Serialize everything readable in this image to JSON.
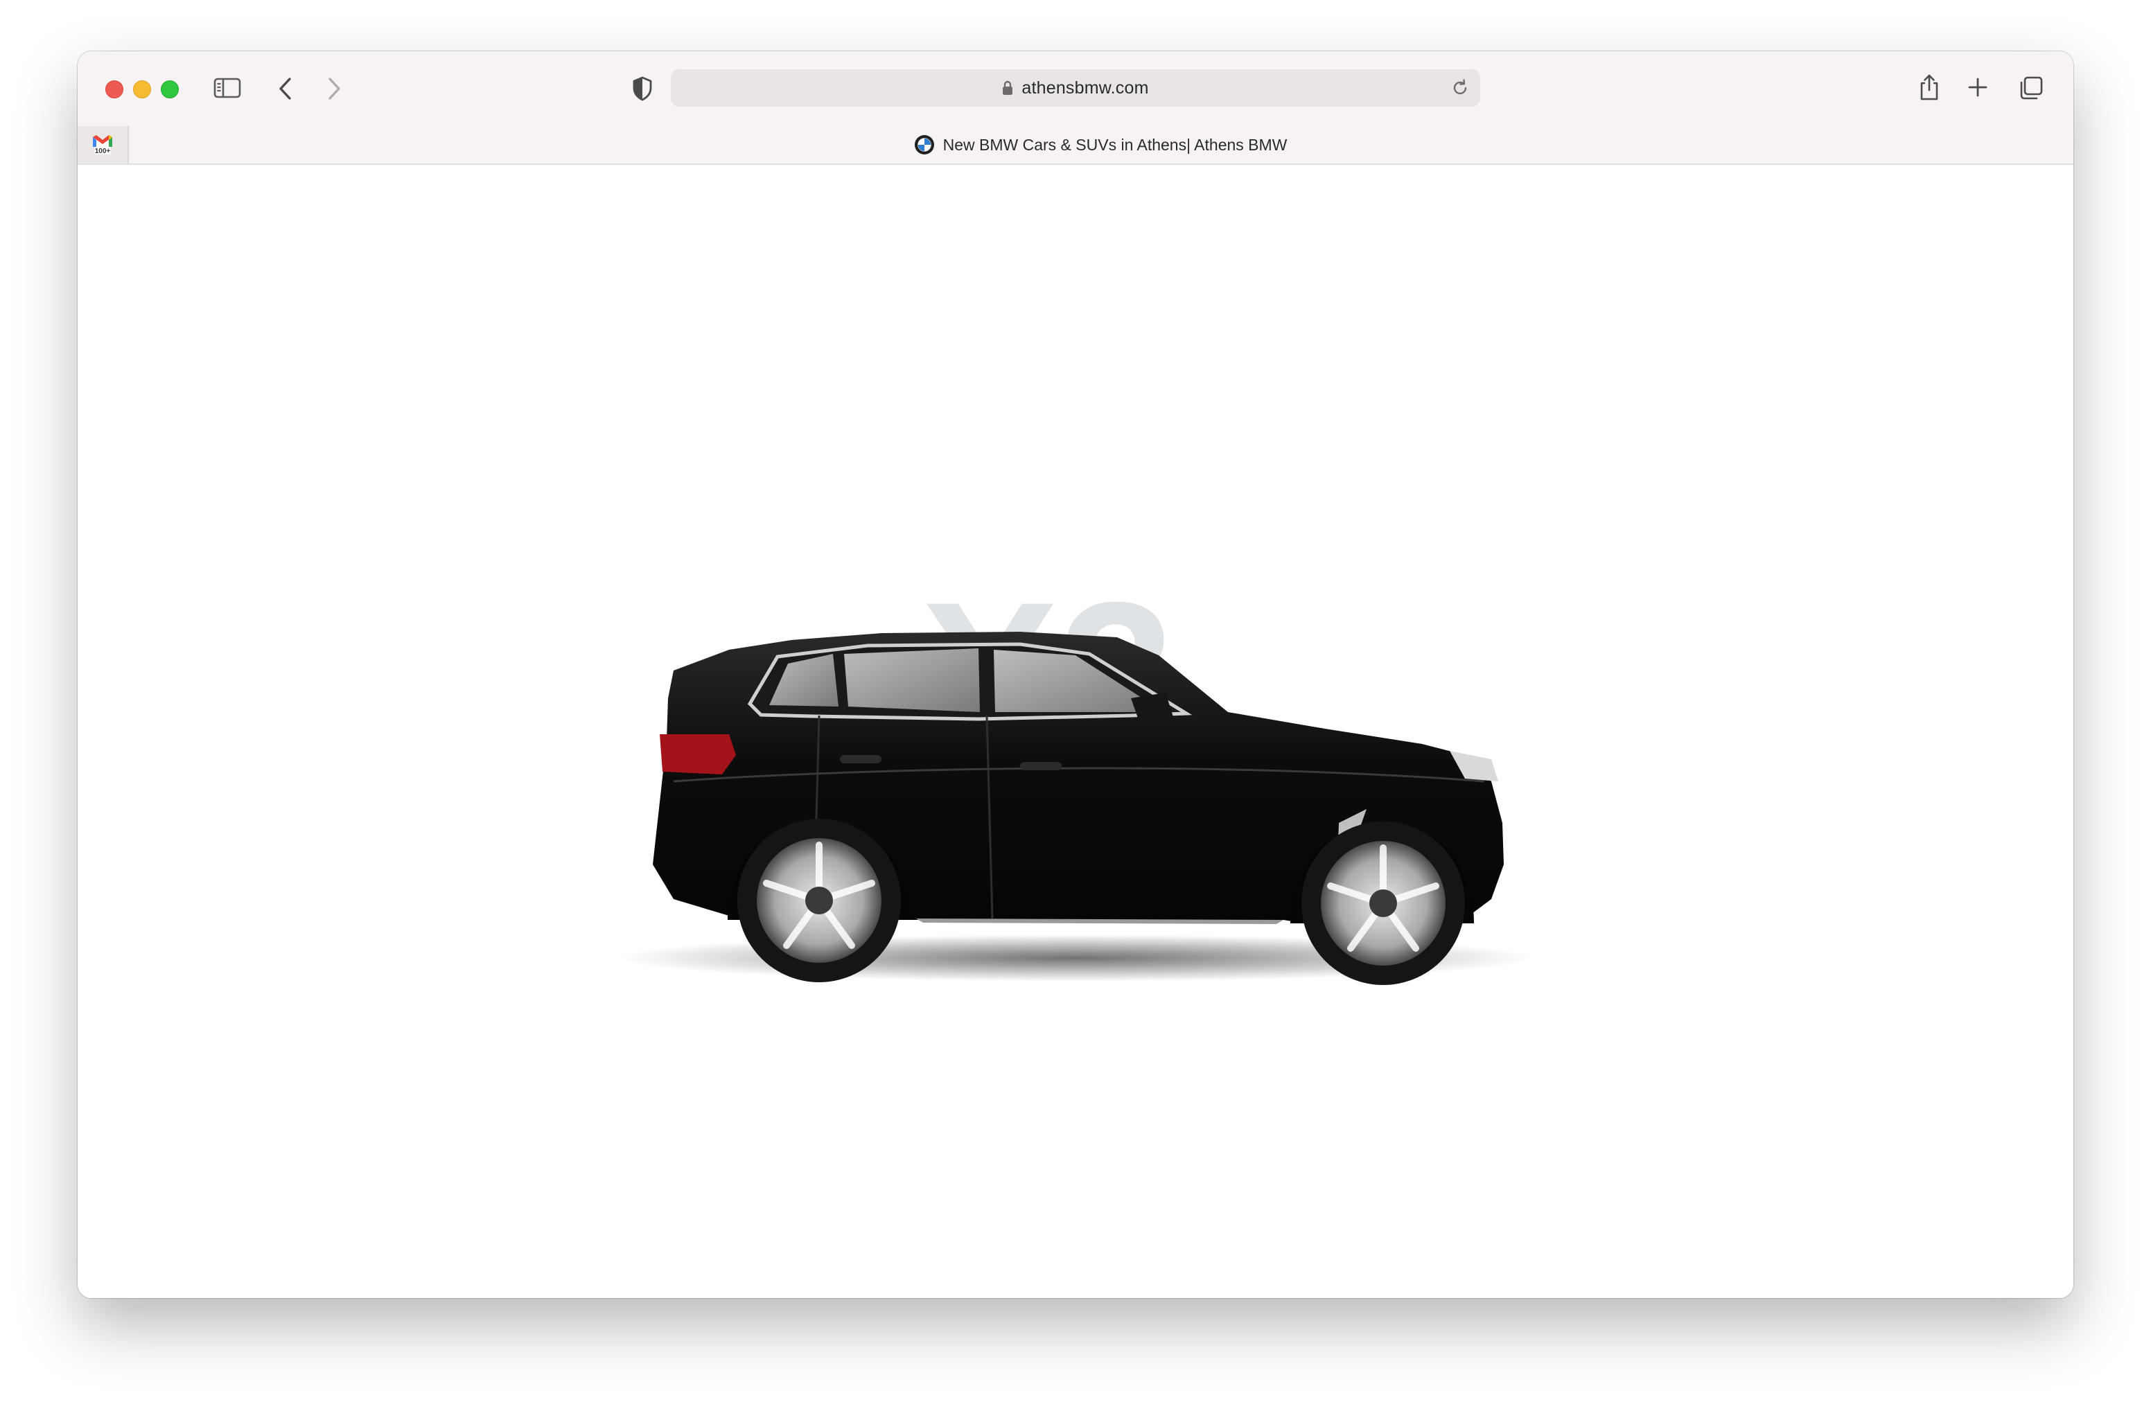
{
  "browser": {
    "url": "athensbmw.com",
    "active_tab_title": "New BMW Cars & SUVs in Athens| Athens BMW",
    "pinned_tab_icon": "gmail-icon",
    "pinned_tab_badge": "100+"
  },
  "hero": {
    "model_watermark": "X3",
    "car_color": "#0d0d0d"
  },
  "chat": {
    "icon": "chat-bubbles-icon"
  },
  "colors": {
    "close": "#ee5a52",
    "minimize": "#f6bb30",
    "maximize": "#2fc740",
    "toolbar": "#f7f3f4",
    "watermark": "#dfe3e6"
  }
}
